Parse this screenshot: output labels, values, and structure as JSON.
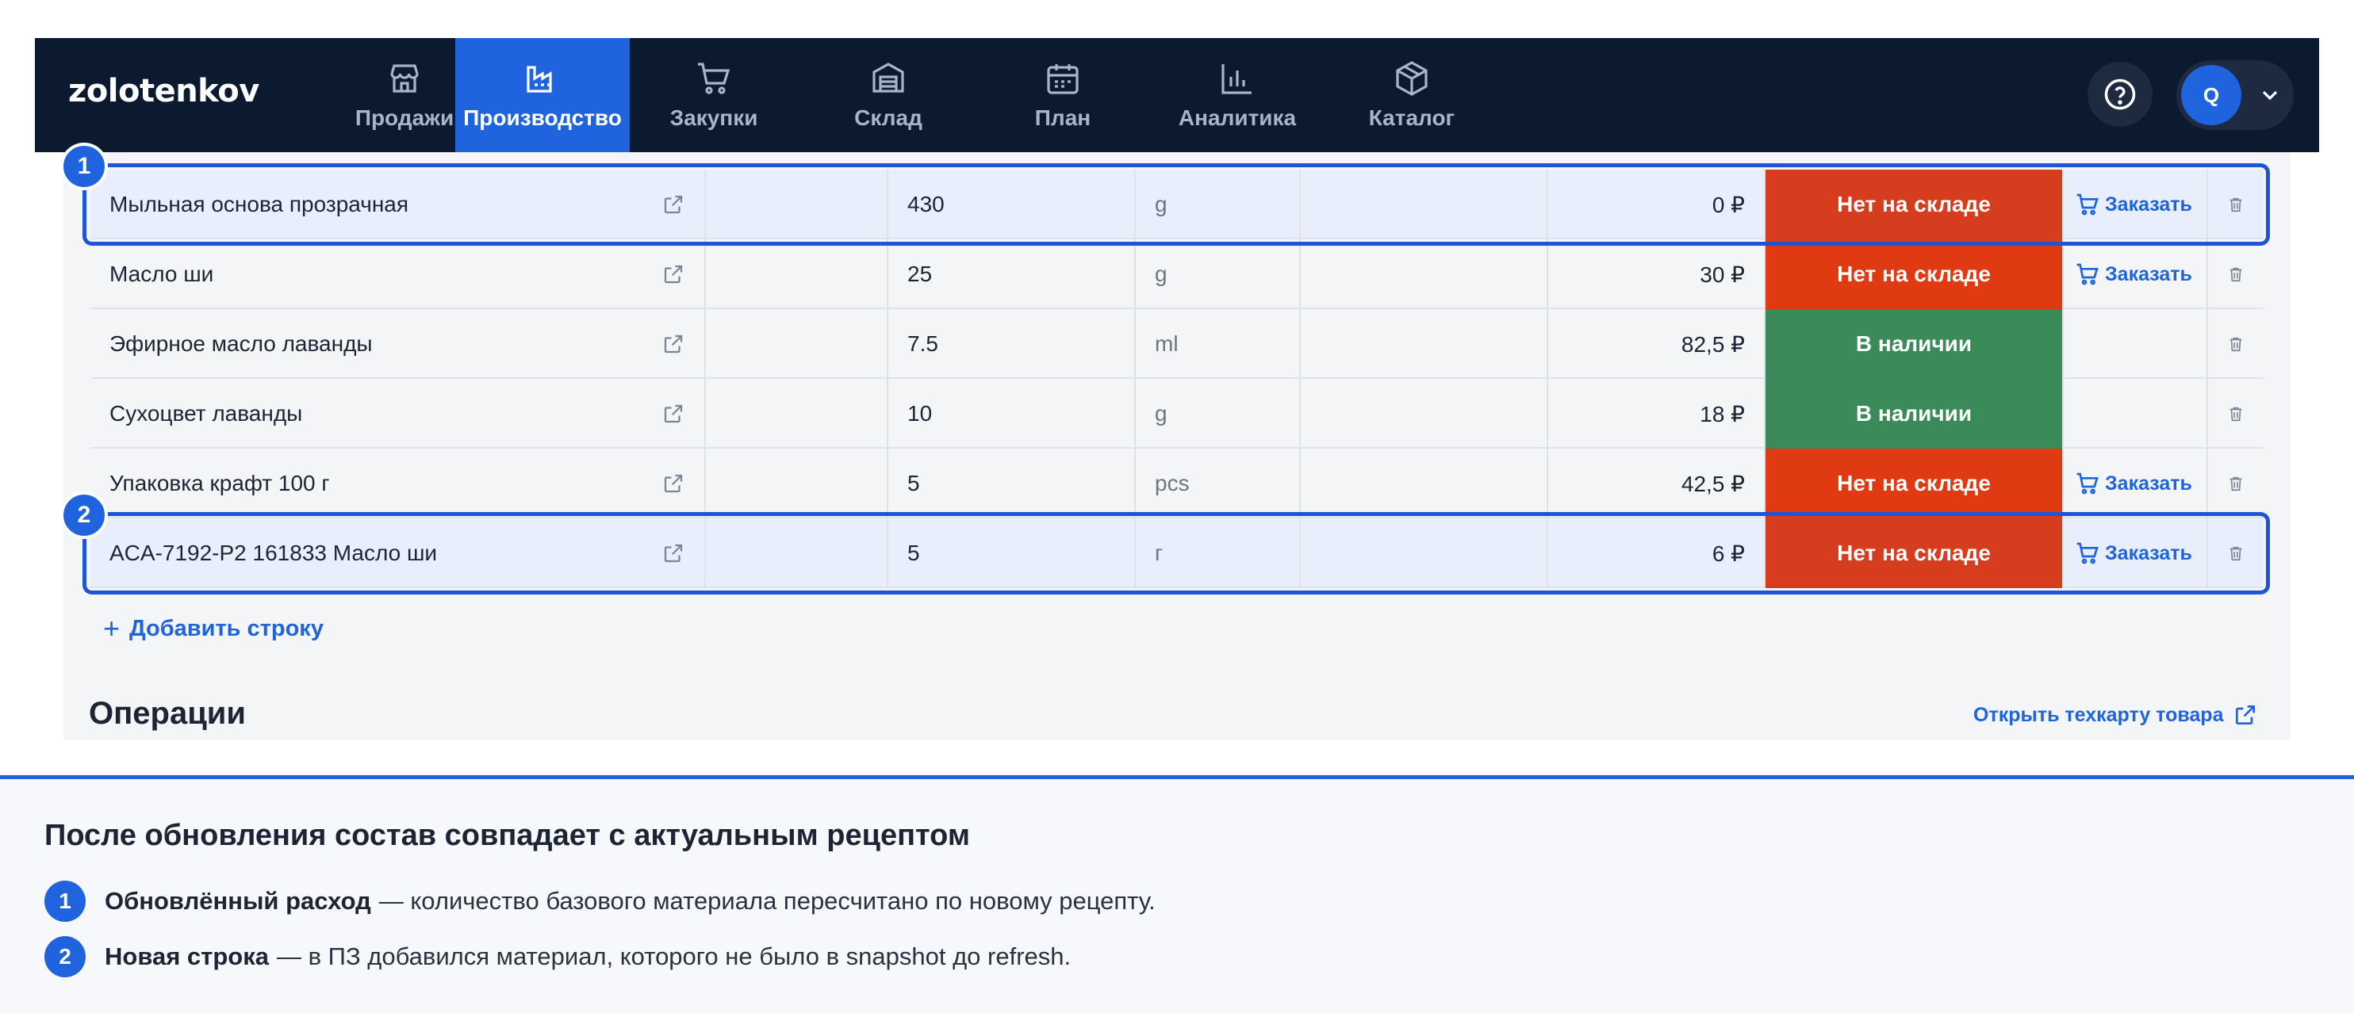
{
  "app": {
    "logo": "zolotenkov"
  },
  "nav": {
    "items": [
      {
        "label": "Продажи",
        "icon": "store-icon"
      },
      {
        "label": "Производство",
        "icon": "factory-icon",
        "active": true
      },
      {
        "label": "Закупки",
        "icon": "cart-icon"
      },
      {
        "label": "Склад",
        "icon": "warehouse-icon"
      },
      {
        "label": "План",
        "icon": "calendar-icon"
      },
      {
        "label": "Аналитика",
        "icon": "bar-chart-icon"
      },
      {
        "label": "Каталог",
        "icon": "box-icon"
      }
    ],
    "user_initial": "Q"
  },
  "table": {
    "rows": [
      {
        "name": "Мыльная основа прозрачная",
        "qty": "430",
        "unit": "g",
        "price": "0 ₽",
        "status": "Нет на складе",
        "order": "Заказать",
        "highlight": true
      },
      {
        "name": "Масло ши",
        "qty": "25",
        "unit": "g",
        "price": "30 ₽",
        "status": "Нет на складе",
        "order": "Заказать"
      },
      {
        "name": "Эфирное масло лаванды",
        "qty": "7.5",
        "unit": "ml",
        "price": "82,5 ₽",
        "status": "В наличии",
        "order": ""
      },
      {
        "name": "Сухоцвет лаванды",
        "qty": "10",
        "unit": "g",
        "price": "18 ₽",
        "status": "В наличии",
        "order": ""
      },
      {
        "name": "Упаковка крафт 100 г",
        "qty": "5",
        "unit": "pcs",
        "price": "42,5 ₽",
        "status": "Нет на складе",
        "order": "Заказать"
      },
      {
        "name": "ACA-7192-P2 161833 Масло ши",
        "qty": "5",
        "unit": "г",
        "price": "6 ₽",
        "status": "Нет на складе",
        "order": "Заказать",
        "highlight": true
      }
    ],
    "add_row": "Добавить строку"
  },
  "badges": [
    "1",
    "2"
  ],
  "operations": {
    "title": "Операции",
    "techcard_link": "Открыть техкарту товара"
  },
  "callout": {
    "title": "После обновления состав совпадает с актуальным рецептом",
    "items": [
      {
        "num": "1",
        "bold": "Обновлённый расход",
        "text": "— количество базового материала пересчитано по новому рецепту."
      },
      {
        "num": "2",
        "bold": "Новая строка",
        "text": "— в ПЗ добавился материал, которого не было в snapshot до refresh."
      }
    ]
  },
  "colors": {
    "nav_bg": "#0c1a2f",
    "accent": "#1f63de",
    "out_of_stock": "#d63c1e",
    "in_stock": "#3a8a5a"
  }
}
